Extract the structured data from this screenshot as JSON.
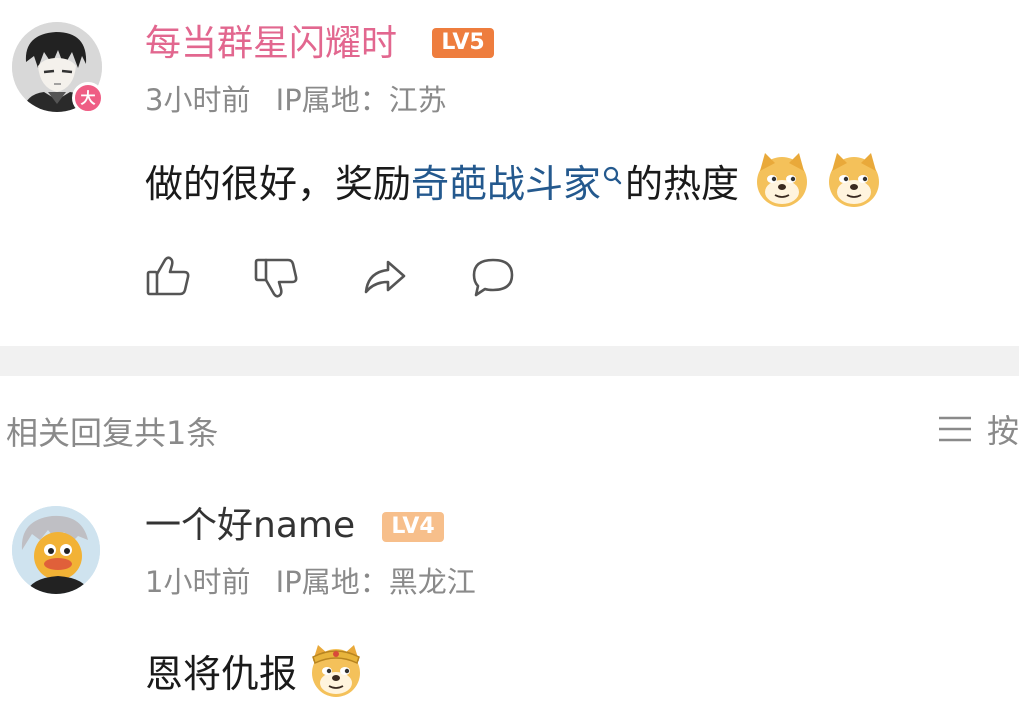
{
  "main_comment": {
    "username": "每当群星闪耀时",
    "level": "LV5",
    "avatar_badge": "大",
    "time": "3小时前",
    "ip_location": "IP属地：江苏",
    "text_before": "做的很好，奖励",
    "topic_link": "奇葩战斗家",
    "text_after": "的热度",
    "emojis": [
      "doge",
      "doge"
    ],
    "colors": {
      "username": "#e2678f",
      "level_badge": "#ee7d3e",
      "avatar_badge": "#ef5d84"
    }
  },
  "replies_section": {
    "title": "相关回复共1条",
    "sort_label": "按"
  },
  "reply": {
    "username": "一个好name",
    "level": "LV4",
    "time": "1小时前",
    "ip_location": "IP属地：黑龙江",
    "text": "恩将仇报",
    "emoji": "doge-monkey-king",
    "colors": {
      "level_badge": "#f7bf8b"
    }
  },
  "actions": [
    "thumbs-up-icon",
    "thumbs-down-icon",
    "share-icon",
    "reply-icon"
  ]
}
